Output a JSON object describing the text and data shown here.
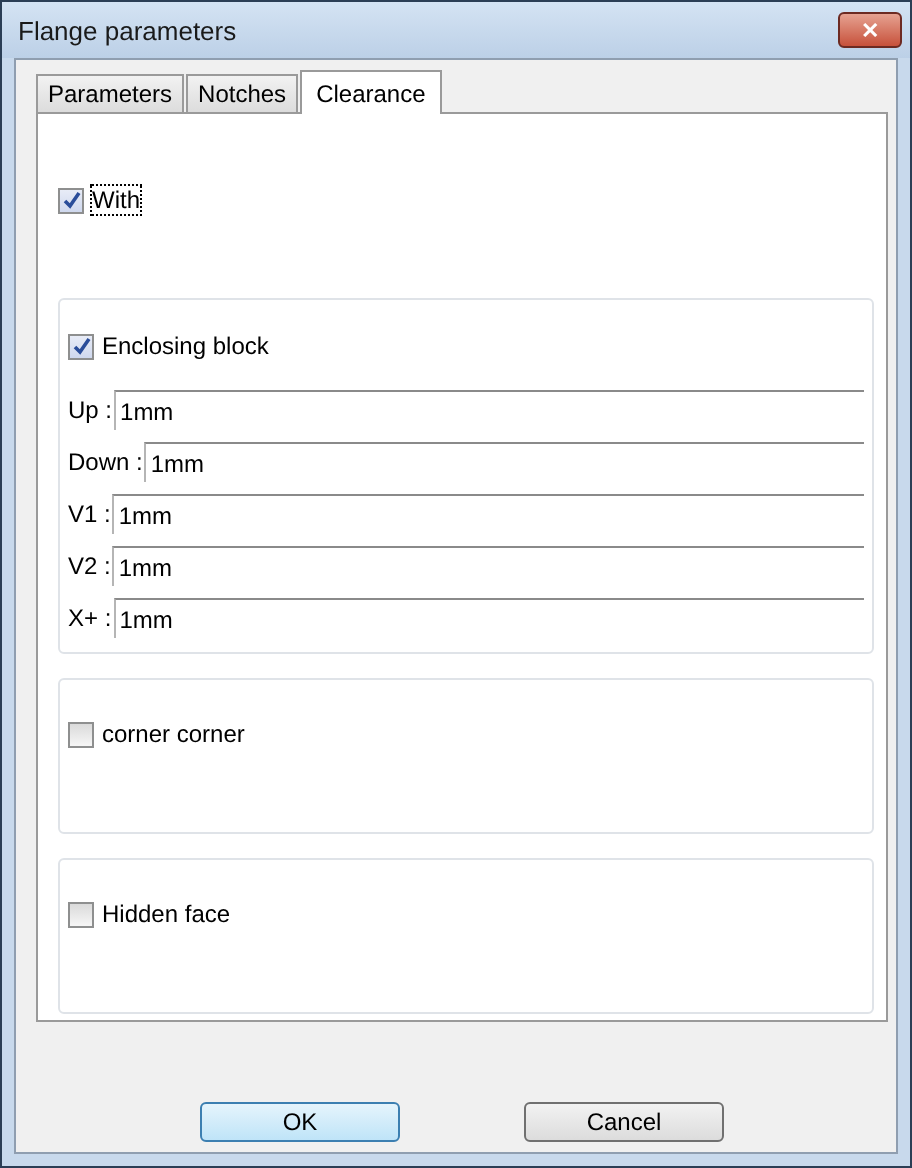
{
  "window": {
    "title": "Flange parameters",
    "close": "✕"
  },
  "tabs": [
    {
      "label": "Parameters",
      "selected": false
    },
    {
      "label": "Notches",
      "selected": false
    },
    {
      "label": "Clearance",
      "selected": true
    }
  ],
  "with": {
    "label": "With",
    "checked": true,
    "focused": true
  },
  "groups": [
    {
      "label": "Enclosing block",
      "checked": true,
      "fields": [
        {
          "label": "Up :",
          "value": "1mm"
        },
        {
          "label": "Down :",
          "value": "1mm"
        },
        {
          "label": "V1 :",
          "value": "1mm"
        },
        {
          "label": "V2 :",
          "value": "1mm"
        },
        {
          "label": "X+ :",
          "value": "1mm"
        }
      ]
    },
    {
      "label": "corner corner",
      "checked": false
    },
    {
      "label": "Hidden face",
      "checked": false
    }
  ],
  "buttons": [
    {
      "label": "OK",
      "default": true
    },
    {
      "label": "Cancel",
      "default": false
    }
  ]
}
